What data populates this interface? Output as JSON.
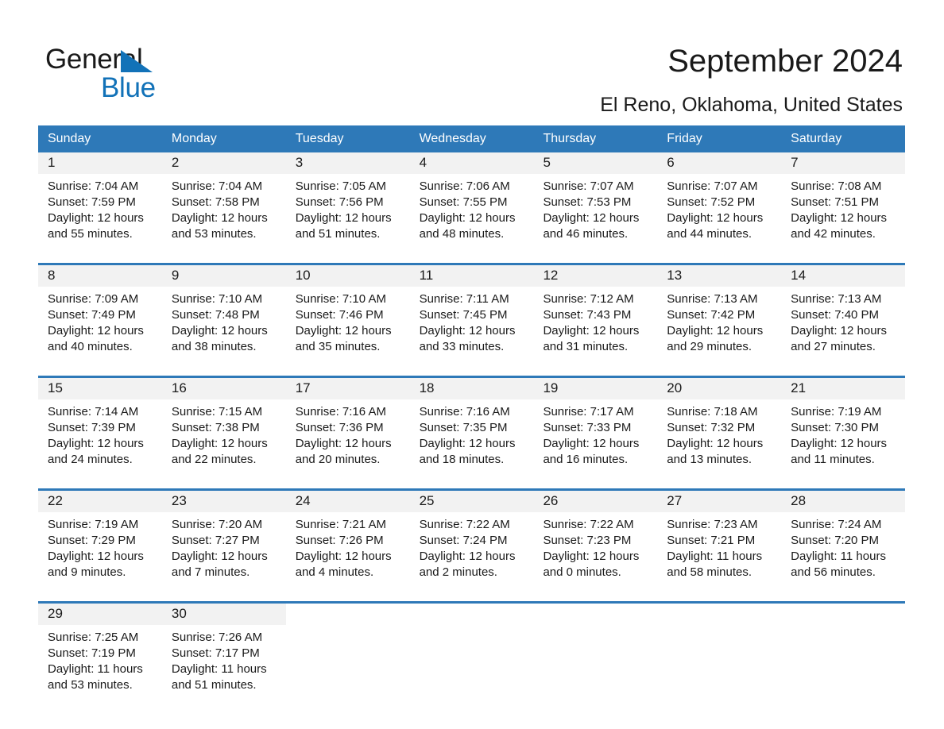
{
  "brand": {
    "name_part1": "General",
    "name_part2": "Blue",
    "accent_color": "#1272b8"
  },
  "header": {
    "title": "September 2024",
    "location": "El Reno, Oklahoma, United States"
  },
  "theme": {
    "header_blue": "#2e79b8",
    "daynum_background": "#f2f2f2",
    "text_color": "#1a1a1a"
  },
  "weekday_headers": [
    "Sunday",
    "Monday",
    "Tuesday",
    "Wednesday",
    "Thursday",
    "Friday",
    "Saturday"
  ],
  "weeks": [
    [
      {
        "day": "1",
        "sunrise": "Sunrise: 7:04 AM",
        "sunset": "Sunset: 7:59 PM",
        "daylight": "Daylight: 12 hours and 55 minutes."
      },
      {
        "day": "2",
        "sunrise": "Sunrise: 7:04 AM",
        "sunset": "Sunset: 7:58 PM",
        "daylight": "Daylight: 12 hours and 53 minutes."
      },
      {
        "day": "3",
        "sunrise": "Sunrise: 7:05 AM",
        "sunset": "Sunset: 7:56 PM",
        "daylight": "Daylight: 12 hours and 51 minutes."
      },
      {
        "day": "4",
        "sunrise": "Sunrise: 7:06 AM",
        "sunset": "Sunset: 7:55 PM",
        "daylight": "Daylight: 12 hours and 48 minutes."
      },
      {
        "day": "5",
        "sunrise": "Sunrise: 7:07 AM",
        "sunset": "Sunset: 7:53 PM",
        "daylight": "Daylight: 12 hours and 46 minutes."
      },
      {
        "day": "6",
        "sunrise": "Sunrise: 7:07 AM",
        "sunset": "Sunset: 7:52 PM",
        "daylight": "Daylight: 12 hours and 44 minutes."
      },
      {
        "day": "7",
        "sunrise": "Sunrise: 7:08 AM",
        "sunset": "Sunset: 7:51 PM",
        "daylight": "Daylight: 12 hours and 42 minutes."
      }
    ],
    [
      {
        "day": "8",
        "sunrise": "Sunrise: 7:09 AM",
        "sunset": "Sunset: 7:49 PM",
        "daylight": "Daylight: 12 hours and 40 minutes."
      },
      {
        "day": "9",
        "sunrise": "Sunrise: 7:10 AM",
        "sunset": "Sunset: 7:48 PM",
        "daylight": "Daylight: 12 hours and 38 minutes."
      },
      {
        "day": "10",
        "sunrise": "Sunrise: 7:10 AM",
        "sunset": "Sunset: 7:46 PM",
        "daylight": "Daylight: 12 hours and 35 minutes."
      },
      {
        "day": "11",
        "sunrise": "Sunrise: 7:11 AM",
        "sunset": "Sunset: 7:45 PM",
        "daylight": "Daylight: 12 hours and 33 minutes."
      },
      {
        "day": "12",
        "sunrise": "Sunrise: 7:12 AM",
        "sunset": "Sunset: 7:43 PM",
        "daylight": "Daylight: 12 hours and 31 minutes."
      },
      {
        "day": "13",
        "sunrise": "Sunrise: 7:13 AM",
        "sunset": "Sunset: 7:42 PM",
        "daylight": "Daylight: 12 hours and 29 minutes."
      },
      {
        "day": "14",
        "sunrise": "Sunrise: 7:13 AM",
        "sunset": "Sunset: 7:40 PM",
        "daylight": "Daylight: 12 hours and 27 minutes."
      }
    ],
    [
      {
        "day": "15",
        "sunrise": "Sunrise: 7:14 AM",
        "sunset": "Sunset: 7:39 PM",
        "daylight": "Daylight: 12 hours and 24 minutes."
      },
      {
        "day": "16",
        "sunrise": "Sunrise: 7:15 AM",
        "sunset": "Sunset: 7:38 PM",
        "daylight": "Daylight: 12 hours and 22 minutes."
      },
      {
        "day": "17",
        "sunrise": "Sunrise: 7:16 AM",
        "sunset": "Sunset: 7:36 PM",
        "daylight": "Daylight: 12 hours and 20 minutes."
      },
      {
        "day": "18",
        "sunrise": "Sunrise: 7:16 AM",
        "sunset": "Sunset: 7:35 PM",
        "daylight": "Daylight: 12 hours and 18 minutes."
      },
      {
        "day": "19",
        "sunrise": "Sunrise: 7:17 AM",
        "sunset": "Sunset: 7:33 PM",
        "daylight": "Daylight: 12 hours and 16 minutes."
      },
      {
        "day": "20",
        "sunrise": "Sunrise: 7:18 AM",
        "sunset": "Sunset: 7:32 PM",
        "daylight": "Daylight: 12 hours and 13 minutes."
      },
      {
        "day": "21",
        "sunrise": "Sunrise: 7:19 AM",
        "sunset": "Sunset: 7:30 PM",
        "daylight": "Daylight: 12 hours and 11 minutes."
      }
    ],
    [
      {
        "day": "22",
        "sunrise": "Sunrise: 7:19 AM",
        "sunset": "Sunset: 7:29 PM",
        "daylight": "Daylight: 12 hours and 9 minutes."
      },
      {
        "day": "23",
        "sunrise": "Sunrise: 7:20 AM",
        "sunset": "Sunset: 7:27 PM",
        "daylight": "Daylight: 12 hours and 7 minutes."
      },
      {
        "day": "24",
        "sunrise": "Sunrise: 7:21 AM",
        "sunset": "Sunset: 7:26 PM",
        "daylight": "Daylight: 12 hours and 4 minutes."
      },
      {
        "day": "25",
        "sunrise": "Sunrise: 7:22 AM",
        "sunset": "Sunset: 7:24 PM",
        "daylight": "Daylight: 12 hours and 2 minutes."
      },
      {
        "day": "26",
        "sunrise": "Sunrise: 7:22 AM",
        "sunset": "Sunset: 7:23 PM",
        "daylight": "Daylight: 12 hours and 0 minutes."
      },
      {
        "day": "27",
        "sunrise": "Sunrise: 7:23 AM",
        "sunset": "Sunset: 7:21 PM",
        "daylight": "Daylight: 11 hours and 58 minutes."
      },
      {
        "day": "28",
        "sunrise": "Sunrise: 7:24 AM",
        "sunset": "Sunset: 7:20 PM",
        "daylight": "Daylight: 11 hours and 56 minutes."
      }
    ],
    [
      {
        "day": "29",
        "sunrise": "Sunrise: 7:25 AM",
        "sunset": "Sunset: 7:19 PM",
        "daylight": "Daylight: 11 hours and 53 minutes."
      },
      {
        "day": "30",
        "sunrise": "Sunrise: 7:26 AM",
        "sunset": "Sunset: 7:17 PM",
        "daylight": "Daylight: 11 hours and 51 minutes."
      },
      {
        "day": "",
        "sunrise": "",
        "sunset": "",
        "daylight": ""
      },
      {
        "day": "",
        "sunrise": "",
        "sunset": "",
        "daylight": ""
      },
      {
        "day": "",
        "sunrise": "",
        "sunset": "",
        "daylight": ""
      },
      {
        "day": "",
        "sunrise": "",
        "sunset": "",
        "daylight": ""
      },
      {
        "day": "",
        "sunrise": "",
        "sunset": "",
        "daylight": ""
      }
    ]
  ]
}
